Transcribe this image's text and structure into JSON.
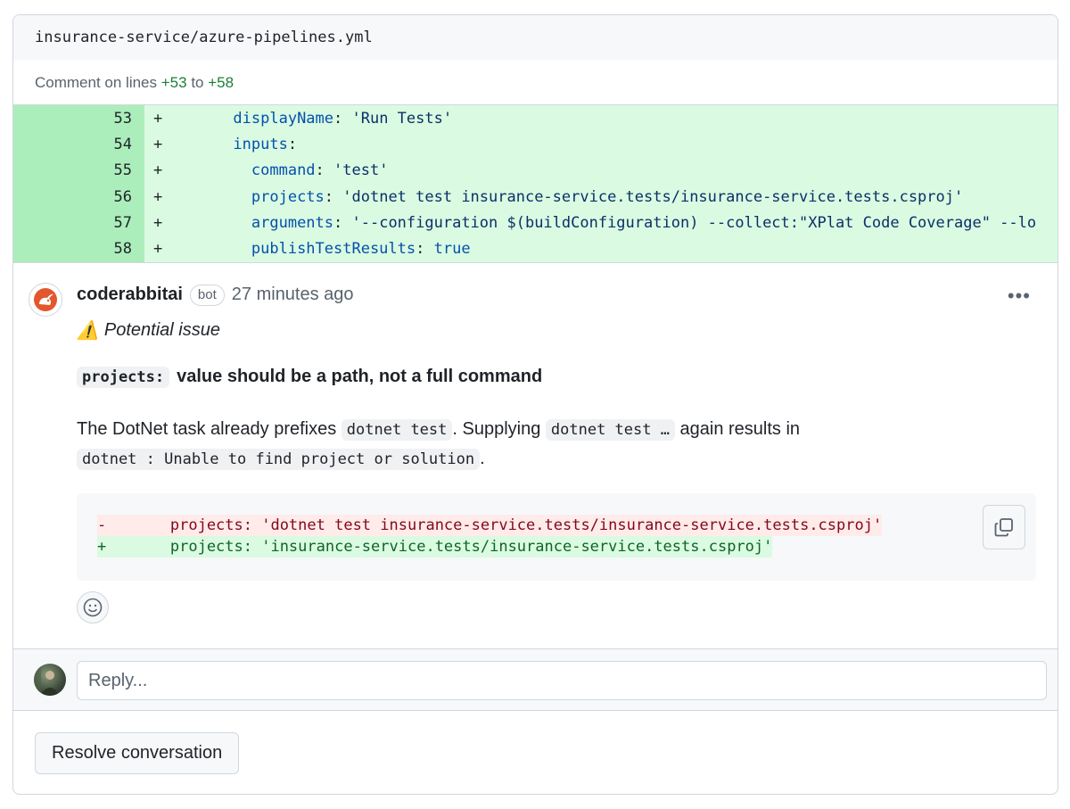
{
  "file": {
    "path": "insurance-service/azure-pipelines.yml"
  },
  "comment_range": {
    "prefix": "Comment on lines",
    "start": "+53",
    "joiner": "to",
    "end": "+58"
  },
  "diff_lines": [
    {
      "num": "53",
      "marker": "+",
      "indent": "      ",
      "key": "displayName",
      "sep": ": ",
      "value": "'Run Tests'",
      "value_type": "str"
    },
    {
      "num": "54",
      "marker": "+",
      "indent": "      ",
      "key": "inputs",
      "sep": ":",
      "value": "",
      "value_type": "str"
    },
    {
      "num": "55",
      "marker": "+",
      "indent": "        ",
      "key": "command",
      "sep": ": ",
      "value": "'test'",
      "value_type": "str"
    },
    {
      "num": "56",
      "marker": "+",
      "indent": "        ",
      "key": "projects",
      "sep": ": ",
      "value": "'dotnet test insurance-service.tests/insurance-service.tests.csproj'",
      "value_type": "str"
    },
    {
      "num": "57",
      "marker": "+",
      "indent": "        ",
      "key": "arguments",
      "sep": ": ",
      "value": "'--configuration $(buildConfiguration) --collect:\"XPlat Code Coverage\" --lo",
      "value_type": "str"
    },
    {
      "num": "58",
      "marker": "+",
      "indent": "        ",
      "key": "publishTestResults",
      "sep": ": ",
      "value": "true",
      "value_type": "bool"
    }
  ],
  "comment": {
    "author": "coderabbitai",
    "badge": "bot",
    "time": "27 minutes ago",
    "menu_glyph": "•••",
    "issue_emoji": "⚠️",
    "issue_label": "Potential issue",
    "headline_code": "projects:",
    "headline_text": "value should be a path, not a full command",
    "body": {
      "t1": "The DotNet task already prefixes ",
      "c1": "dotnet test",
      "t2": ". Supplying ",
      "c2": "dotnet test …",
      "t3": " again results in",
      "c3": "dotnet : Unable to find project or solution",
      "t4": "."
    },
    "suggestion": {
      "removed": "-       projects: 'dotnet test insurance-service.tests/insurance-service.tests.csproj'",
      "added": "+       projects: 'insurance-service.tests/insurance-service.tests.csproj'"
    }
  },
  "reply": {
    "placeholder": "Reply..."
  },
  "resolve": {
    "label": "Resolve conversation"
  },
  "colors": {
    "addition_bg": "#dafbe1",
    "addition_gutter": "#aceebb",
    "deletion_bg": "#ffebe9",
    "brand_bot": "#e2572c"
  }
}
